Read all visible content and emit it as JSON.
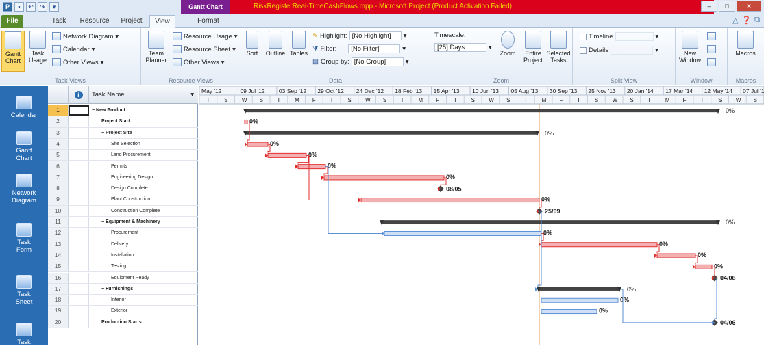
{
  "window": {
    "title": "RiskRegisterReal-TimeCashFlows.mpp - Microsoft Project (Product Activation Failed)",
    "context_tab": "Gantt Chart Tools"
  },
  "ribbon_tabs": [
    {
      "label": "File"
    },
    {
      "label": "Task"
    },
    {
      "label": "Resource"
    },
    {
      "label": "Project"
    },
    {
      "label": "View"
    },
    {
      "label": "Format"
    }
  ],
  "ribbon": {
    "task_views": {
      "group_label": "Task Views",
      "gantt_chart": "Gantt Chart",
      "task_usage": "Task Usage",
      "network_diagram": "Network Diagram",
      "calendar": "Calendar",
      "other_views": "Other Views"
    },
    "resource_views": {
      "group_label": "Resource Views",
      "team_planner": "Team Planner",
      "resource_usage": "Resource Usage",
      "resource_sheet": "Resource Sheet",
      "other_views": "Other Views"
    },
    "data": {
      "group_label": "Data",
      "sort": "Sort",
      "outline": "Outline",
      "tables": "Tables",
      "highlight_label": "Highlight:",
      "highlight_value": "[No Highlight]",
      "filter_label": "Filter:",
      "filter_value": "[No Filter]",
      "group_label_text": "Group by:",
      "group_value": "[No Group]"
    },
    "zoom": {
      "group_label": "Zoom",
      "timescale_label": "Timescale:",
      "timescale_value": "[25] Days",
      "zoom": "Zoom",
      "entire_project": "Entire Project",
      "selected_tasks": "Selected Tasks"
    },
    "split_view": {
      "group_label": "Split View",
      "timeline": "Timeline",
      "details": "Details"
    },
    "window_group": {
      "group_label": "Window",
      "new_window": "New Window"
    },
    "macros": {
      "group_label": "Macros",
      "macros": "Macros"
    }
  },
  "sidebar": [
    {
      "label": "Calendar",
      "icon": "calendar-icon"
    },
    {
      "label": "Gantt Chart",
      "icon": "gantt-icon"
    },
    {
      "label": "Network Diagram",
      "icon": "network-icon"
    },
    {
      "label": "Task Form",
      "icon": "task-form-icon"
    },
    {
      "label": "Task Sheet",
      "icon": "task-sheet-icon"
    },
    {
      "label": "Task",
      "icon": "task-icon"
    }
  ],
  "grid": {
    "header_task_name": "Task Name",
    "tasks": [
      {
        "id": "1",
        "name": "− New Product"
      },
      {
        "id": "2",
        "name": "Project Start"
      },
      {
        "id": "3",
        "name": "− Project Site"
      },
      {
        "id": "4",
        "name": "Site Selection"
      },
      {
        "id": "5",
        "name": "Land Procurement"
      },
      {
        "id": "6",
        "name": "Permits"
      },
      {
        "id": "7",
        "name": "Engineering Design"
      },
      {
        "id": "8",
        "name": "Design Complete"
      },
      {
        "id": "9",
        "name": "Plant Construction"
      },
      {
        "id": "10",
        "name": "Construction Complete"
      },
      {
        "id": "11",
        "name": "− Equipment & Machinery"
      },
      {
        "id": "12",
        "name": "Procurement"
      },
      {
        "id": "13",
        "name": "Delivery"
      },
      {
        "id": "14",
        "name": "Installation"
      },
      {
        "id": "15",
        "name": "Testing"
      },
      {
        "id": "16",
        "name": "Equipment Ready"
      },
      {
        "id": "17",
        "name": "− Furnishings"
      },
      {
        "id": "18",
        "name": "Interior"
      },
      {
        "id": "19",
        "name": "Exterior"
      },
      {
        "id": "20",
        "name": "Production Starts"
      }
    ]
  },
  "timescale": {
    "top": [
      "May '12",
      "09 Jul '12",
      "03 Sep '12",
      "29 Oct '12",
      "24 Dec '12",
      "18 Feb '13",
      "15 Apr '13",
      "10 Jun '13",
      "05 Aug '13",
      "30 Sep '13",
      "25 Nov '13",
      "20 Jan '14",
      "17 Mar '14",
      "12 May '14",
      "07 Jul '1"
    ],
    "bottom": [
      "T",
      "S",
      "W",
      "S",
      "T",
      "M",
      "F",
      "T",
      "S",
      "W",
      "S",
      "T",
      "M",
      "F",
      "T",
      "S",
      "W",
      "S",
      "T",
      "M",
      "F",
      "T",
      "S",
      "W",
      "S",
      "T",
      "M",
      "F",
      "T",
      "S",
      "W",
      "S"
    ]
  },
  "gantt": [
    {
      "row": 1,
      "type": "summary",
      "start": 66,
      "end": 758,
      "label": "0%"
    },
    {
      "row": 2,
      "type": "task",
      "start": 66,
      "end": 70,
      "label": "0%"
    },
    {
      "row": 3,
      "type": "summary",
      "start": 66,
      "end": 494,
      "label": "0%"
    },
    {
      "row": 4,
      "type": "task",
      "start": 70,
      "end": 100,
      "label": "0%"
    },
    {
      "row": 5,
      "type": "task",
      "start": 100,
      "end": 156,
      "label": "0%"
    },
    {
      "row": 6,
      "type": "task",
      "start": 144,
      "end": 184,
      "label": "0%"
    },
    {
      "row": 7,
      "type": "task",
      "start": 182,
      "end": 357,
      "label": "0%"
    },
    {
      "row": 8,
      "type": "milestone",
      "start": 352,
      "label": "08/05"
    },
    {
      "row": 9,
      "type": "task",
      "start": 236,
      "end": 496,
      "label": "0%"
    },
    {
      "row": 10,
      "type": "milestone",
      "start": 496,
      "label": "25/09"
    },
    {
      "row": 11,
      "type": "summary",
      "start": 265,
      "end": 758,
      "label": "0%"
    },
    {
      "row": 12,
      "type": "task-blue",
      "start": 270,
      "end": 499,
      "label": "0%"
    },
    {
      "row": 13,
      "type": "task",
      "start": 499,
      "end": 668,
      "label": "0%"
    },
    {
      "row": 14,
      "type": "task",
      "start": 668,
      "end": 724,
      "label": "0%"
    },
    {
      "row": 15,
      "type": "task",
      "start": 724,
      "end": 748,
      "label": "0%"
    },
    {
      "row": 16,
      "type": "milestone",
      "start": 752,
      "label": "04/06"
    },
    {
      "row": 17,
      "type": "summary",
      "start": 494,
      "end": 614,
      "label": "0%"
    },
    {
      "row": 18,
      "type": "task-blue",
      "start": 499,
      "end": 611,
      "label": "0%"
    },
    {
      "row": 19,
      "type": "task-blue",
      "start": 499,
      "end": 580,
      "label": "0%"
    },
    {
      "row": 20,
      "type": "milestone",
      "start": 752,
      "label": "04/06"
    }
  ]
}
